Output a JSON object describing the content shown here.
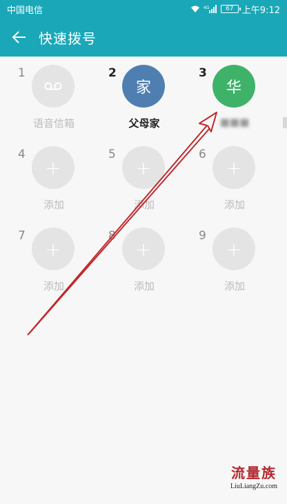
{
  "status_bar": {
    "carrier": "中国电信",
    "battery": "67",
    "time": "上午9:12"
  },
  "app_bar": {
    "back_icon": "arrow-left-icon",
    "title": "快速拨号"
  },
  "slots": [
    {
      "number": "1",
      "avatar": "",
      "label": "语音信箱",
      "state": "voicemail"
    },
    {
      "number": "2",
      "avatar": "家",
      "label": "父母家",
      "state": "assigned",
      "color": "#4f7fb0"
    },
    {
      "number": "3",
      "avatar": "华",
      "label": "",
      "state": "assigned",
      "color": "#3fb26a"
    },
    {
      "number": "4",
      "avatar": "+",
      "label": "添加",
      "state": "empty"
    },
    {
      "number": "5",
      "avatar": "+",
      "label": "添加",
      "state": "empty"
    },
    {
      "number": "6",
      "avatar": "+",
      "label": "添加",
      "state": "empty"
    },
    {
      "number": "7",
      "avatar": "+",
      "label": "添加",
      "state": "empty"
    },
    {
      "number": "8",
      "avatar": "+",
      "label": "添加",
      "state": "empty"
    },
    {
      "number": "9",
      "avatar": "+",
      "label": "添加",
      "state": "empty"
    }
  ],
  "watermark": {
    "logo": "流量族",
    "url": "LiuLiangZu.com"
  },
  "colors": {
    "accent": "#1aa8b8",
    "annotation_arrow": "#c0282d"
  }
}
